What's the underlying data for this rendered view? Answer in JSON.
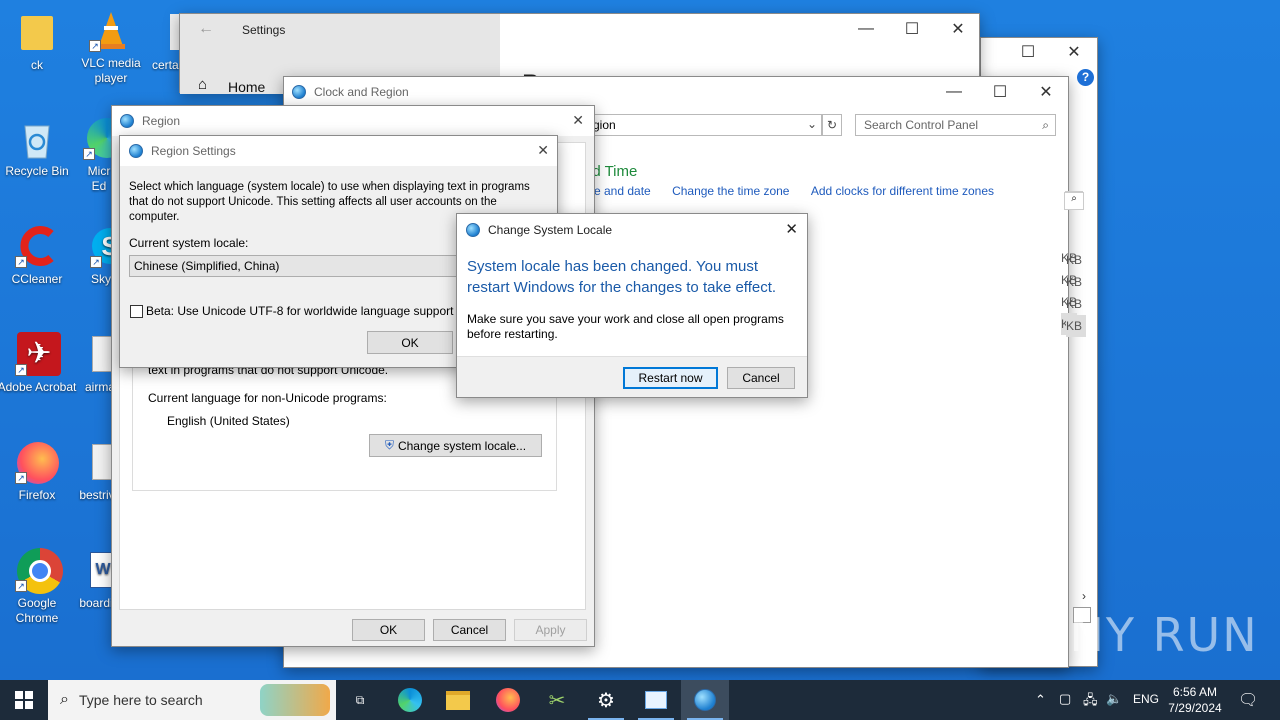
{
  "desktop": {
    "icons": [
      {
        "label": "ck"
      },
      {
        "label": "VLC media player"
      },
      {
        "label": "certa"
      },
      {
        "label": "Recycle Bin"
      },
      {
        "label": "Micr Ed"
      },
      {
        "label": "CCleaner"
      },
      {
        "label": "Sky"
      },
      {
        "label": "Adobe Acrobat"
      },
      {
        "label": "airma"
      },
      {
        "label": "Firefox"
      },
      {
        "label": "bestriv"
      },
      {
        "label": "Google Chrome"
      },
      {
        "label": "boardi"
      }
    ]
  },
  "settings_window": {
    "title": "Settings",
    "home_label": "Home"
  },
  "control_panel": {
    "title": "Clock and Region",
    "address": "gion",
    "search_placeholder": "Search Control Panel",
    "heading": "nd Time",
    "links": [
      "me and date",
      "Change the time zone",
      "Add clocks for different time zones"
    ],
    "right_sizes": [
      "KB",
      "KB",
      "KB",
      "KB"
    ]
  },
  "region_dialog": {
    "title": "Region",
    "unicode_text": "text in programs that do not support Unicode.",
    "current_lang_label": "Current language for non-Unicode programs:",
    "current_lang_value": "English (United States)",
    "change_locale_btn": "Change system locale...",
    "ok": "OK",
    "cancel": "Cancel",
    "apply": "Apply"
  },
  "region_settings": {
    "title": "Region Settings",
    "description": "Select which language (system locale) to use when displaying text in programs that do not support Unicode. This setting affects all user accounts on the computer.",
    "current_locale_label": "Current system locale:",
    "current_locale_value": "Chinese (Simplified, China)",
    "beta_label": "Beta: Use Unicode UTF-8 for worldwide language support",
    "ok": "OK"
  },
  "change_locale_dialog": {
    "title": "Change System Locale",
    "main_message": "System locale has been changed. You must restart Windows for the changes to take effect.",
    "sub_message": "Make sure you save your work and close all open programs before restarting.",
    "restart_btn": "Restart now",
    "cancel_btn": "Cancel"
  },
  "taskbar": {
    "search_placeholder": "Type here to search",
    "language": "ENG",
    "time": "6:56 AM",
    "date": "7/29/2024"
  },
  "watermark": "ANY RUN",
  "colors": {
    "accent": "#0078d7",
    "link": "#1f5bbd",
    "heading_green": "#1e8a3c",
    "dialog_message": "#1a5aa8"
  }
}
